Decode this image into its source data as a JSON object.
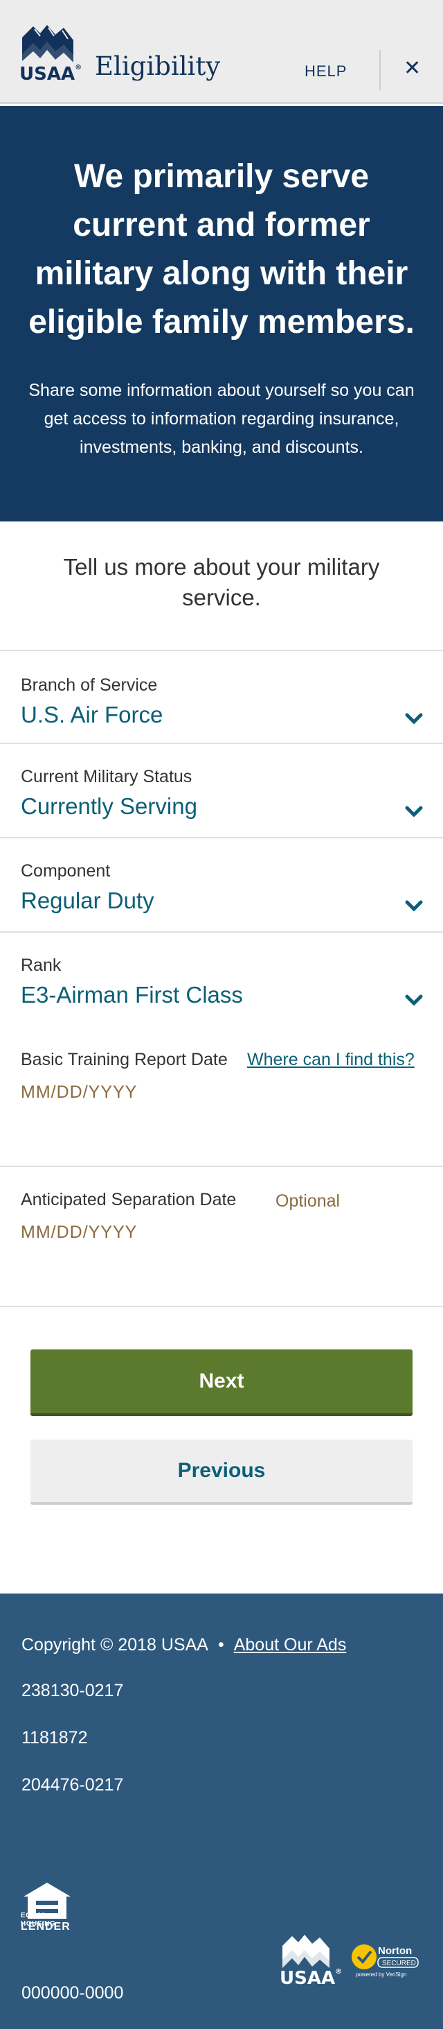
{
  "header": {
    "logo_text": "USAA",
    "title": "Eligibility",
    "help_label": "HELP",
    "close_label": "✕"
  },
  "hero": {
    "heading": "We primarily serve current and former military along with their eligible family members.",
    "body": "Share some information about yourself so you can get access to information regarding insurance, investments, banking, and discounts."
  },
  "intro": "Tell us more about your military service.",
  "form": {
    "branch": {
      "label": "Branch of Service",
      "value": "U.S. Air Force"
    },
    "status": {
      "label": "Current Military Status",
      "value": "Currently Serving"
    },
    "component": {
      "label": "Component",
      "value": "Regular Duty"
    },
    "rank": {
      "label": "Rank",
      "value": "E3-Airman First Class"
    },
    "training_date": {
      "label": "Basic Training Report Date",
      "help_link": "Where can I find this?",
      "placeholder": "MM/DD/YYYY"
    },
    "separation_date": {
      "label": "Anticipated Separation Date",
      "optional": "Optional",
      "placeholder": "MM/DD/YYYY"
    }
  },
  "buttons": {
    "next": "Next",
    "previous": "Previous"
  },
  "footer": {
    "copyright": "Copyright © 2018 USAA",
    "bullet": "•",
    "about_ads": "About Our Ads",
    "codes": [
      "238130-0217",
      "1181872",
      "204476-0217"
    ],
    "ehl_text": "EQUAL HOUSING",
    "ehl_lender": "LENDER",
    "logo_text": "USAA",
    "norton_label": "Norton",
    "norton_secured": "SECURED",
    "norton_powered": "powered by VeriSign",
    "phone": "000000-0000"
  },
  "colors": {
    "navy": "#12325b",
    "hero": "#153a61",
    "teal": "#0b6077",
    "green": "#5b7a2d",
    "footer": "#2e597d",
    "placeholder": "#8b6a3e"
  }
}
